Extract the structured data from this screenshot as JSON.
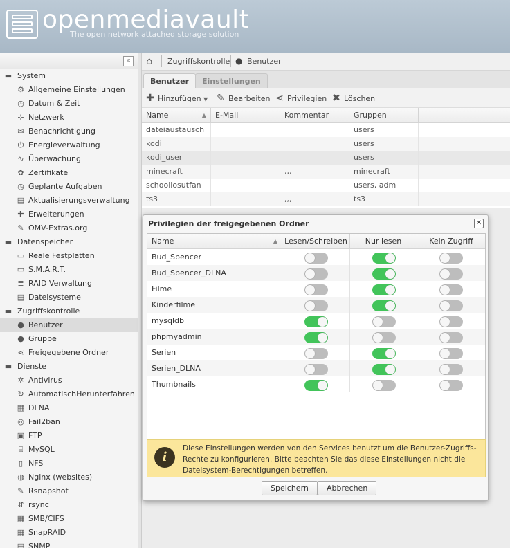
{
  "header": {
    "logo_text": "openmediavault",
    "subtitle": "The open network attached storage solution"
  },
  "sidebar": {
    "collapse_glyph": "«",
    "items": [
      {
        "type": "group",
        "label": "System",
        "icon": "folder-icon",
        "glyph": "▬"
      },
      {
        "type": "child",
        "label": "Allgemeine Einstellungen",
        "icon": "gears-icon",
        "glyph": "⚙"
      },
      {
        "type": "child",
        "label": "Datum & Zeit",
        "icon": "clock-icon",
        "glyph": "◷"
      },
      {
        "type": "child",
        "label": "Netzwerk",
        "icon": "network-icon",
        "glyph": "⊹"
      },
      {
        "type": "child",
        "label": "Benachrichtigung",
        "icon": "mail-icon",
        "glyph": "✉"
      },
      {
        "type": "child",
        "label": "Energieverwaltung",
        "icon": "power-icon",
        "glyph": "⏻"
      },
      {
        "type": "child",
        "label": "Überwachung",
        "icon": "chart-icon",
        "glyph": "∿"
      },
      {
        "type": "child",
        "label": "Zertifikate",
        "icon": "certificate-icon",
        "glyph": "✿"
      },
      {
        "type": "child",
        "label": "Geplante Aufgaben",
        "icon": "alarm-icon",
        "glyph": "◷"
      },
      {
        "type": "child",
        "label": "Aktualisierungsverwaltung",
        "icon": "update-icon",
        "glyph": "▤"
      },
      {
        "type": "child",
        "label": "Erweiterungen",
        "icon": "plugin-icon",
        "glyph": "✚"
      },
      {
        "type": "child",
        "label": "OMV-Extras.org",
        "icon": "wrench-icon",
        "glyph": "✎"
      },
      {
        "type": "group",
        "label": "Datenspeicher",
        "icon": "folder-icon",
        "glyph": "▬"
      },
      {
        "type": "child",
        "label": "Reale Festplatten",
        "icon": "disk-icon",
        "glyph": "▭"
      },
      {
        "type": "child",
        "label": "S.M.A.R.T.",
        "icon": "smart-icon",
        "glyph": "▭"
      },
      {
        "type": "child",
        "label": "RAID Verwaltung",
        "icon": "raid-icon",
        "glyph": "≣"
      },
      {
        "type": "child",
        "label": "Dateisysteme",
        "icon": "filesystem-icon",
        "glyph": "▤"
      },
      {
        "type": "group",
        "label": "Zugriffskontrolle",
        "icon": "folder-icon",
        "glyph": "▬"
      },
      {
        "type": "child",
        "label": "Benutzer",
        "icon": "user-icon",
        "glyph": "●",
        "active": true
      },
      {
        "type": "child",
        "label": "Gruppe",
        "icon": "group-icon",
        "glyph": "●"
      },
      {
        "type": "child",
        "label": "Freigegebene Ordner",
        "icon": "share-icon",
        "glyph": "⋖"
      },
      {
        "type": "group",
        "label": "Dienste",
        "icon": "folder-icon",
        "glyph": "▬"
      },
      {
        "type": "child",
        "label": "Antivirus",
        "icon": "bug-icon",
        "glyph": "✲"
      },
      {
        "type": "child",
        "label": "AutomatischHerunterfahren",
        "icon": "shutdown-icon",
        "glyph": "↻"
      },
      {
        "type": "child",
        "label": "DLNA",
        "icon": "film-icon",
        "glyph": "▦"
      },
      {
        "type": "child",
        "label": "Fail2ban",
        "icon": "fail2ban-icon",
        "glyph": "◎"
      },
      {
        "type": "child",
        "label": "FTP",
        "icon": "ftp-icon",
        "glyph": "▣"
      },
      {
        "type": "child",
        "label": "MySQL",
        "icon": "database-icon",
        "glyph": "⌸"
      },
      {
        "type": "child",
        "label": "NFS",
        "icon": "nfs-icon",
        "glyph": "▯"
      },
      {
        "type": "child",
        "label": "Nginx (websites)",
        "icon": "globe-icon",
        "glyph": "◍"
      },
      {
        "type": "child",
        "label": "Rsnapshot",
        "icon": "snapshot-icon",
        "glyph": "✎"
      },
      {
        "type": "child",
        "label": "rsync",
        "icon": "rsync-icon",
        "glyph": "⇵"
      },
      {
        "type": "child",
        "label": "SMB/CIFS",
        "icon": "windows-icon",
        "glyph": "▦"
      },
      {
        "type": "child",
        "label": "SnapRAID",
        "icon": "snapraid-icon",
        "glyph": "▦"
      },
      {
        "type": "child",
        "label": "SNMP",
        "icon": "snmp-icon",
        "glyph": "▤"
      }
    ]
  },
  "breadcrumb": {
    "section": "Zugriffskontrolle",
    "page": "Benutzer"
  },
  "tabs": {
    "users": "Benutzer",
    "settings": "Einstellungen"
  },
  "toolbar": {
    "add": "Hinzufügen",
    "edit": "Bearbeiten",
    "privileges": "Privilegien",
    "delete": "Löschen"
  },
  "users_grid": {
    "columns": [
      "Name",
      "E-Mail",
      "Kommentar",
      "Gruppen"
    ],
    "rows": [
      {
        "name": "dateiaustausch",
        "email": "",
        "comment": "",
        "groups": "users"
      },
      {
        "name": "kodi",
        "email": "",
        "comment": "",
        "groups": "users"
      },
      {
        "name": "kodi_user",
        "email": "",
        "comment": "",
        "groups": "users",
        "selected": true
      },
      {
        "name": "minecraft",
        "email": "",
        "comment": ",,,",
        "groups": "minecraft"
      },
      {
        "name": "schooliosutfan",
        "email": "",
        "comment": "",
        "groups": "users, adm"
      },
      {
        "name": "ts3",
        "email": "",
        "comment": ",,,",
        "groups": "ts3"
      }
    ]
  },
  "dialog": {
    "title": "Privilegien der freigegebenen Ordner",
    "columns": [
      "Name",
      "Lesen/Schreiben",
      "Nur lesen",
      "Kein Zugriff"
    ],
    "rows": [
      {
        "name": "Bud_Spencer",
        "perm": "read"
      },
      {
        "name": "Bud_Spencer_DLNA",
        "perm": "read"
      },
      {
        "name": "Filme",
        "perm": "read"
      },
      {
        "name": "Kinderfilme",
        "perm": "read"
      },
      {
        "name": "mysqldb",
        "perm": "write"
      },
      {
        "name": "phpmyadmin",
        "perm": "write"
      },
      {
        "name": "Serien",
        "perm": "read"
      },
      {
        "name": "Serien_DLNA",
        "perm": "read"
      },
      {
        "name": "Thumbnails",
        "perm": "write"
      }
    ],
    "info_text": "Diese Einstellungen werden von den Services benutzt um die Benutzer-Zugriffs-Rechte zu konfigurieren. Bitte beachten Sie das diese Einstellungen nicht die Dateisystem-Berechtigungen betreffen.",
    "save": "Speichern",
    "cancel": "Abbrechen"
  },
  "colors": {
    "toggle_on": "#42c45a",
    "toggle_off": "#bdbdbd",
    "info_bg": "#fbe69b",
    "header_bg": "#b3c2cf"
  }
}
